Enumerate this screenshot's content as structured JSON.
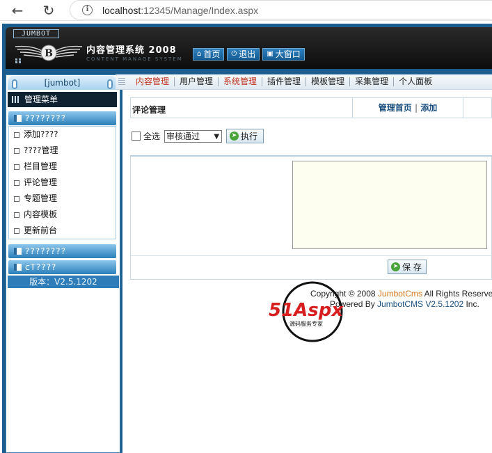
{
  "browser": {
    "url_host": "localhost",
    "url_path": ":12345/Manage/Index.aspx"
  },
  "header": {
    "brand_tag": "JUMBOT",
    "title": "内容管理系统 2008",
    "subtitle": "CONTENT MANAGE SYSTEM",
    "buttons": [
      {
        "label": "首页",
        "icon": "home-icon"
      },
      {
        "label": "退出",
        "icon": "power-icon"
      },
      {
        "label": "大窗口",
        "icon": "fullscreen-icon"
      }
    ]
  },
  "sidebar": {
    "user": "[jumbot]",
    "menu_title": "管理菜单",
    "section1": "????????",
    "items": [
      {
        "label": "添加????"
      },
      {
        "label": "????管理"
      },
      {
        "label": "栏目管理"
      },
      {
        "label": "评论管理"
      },
      {
        "label": "专题管理"
      },
      {
        "label": "内容模板"
      },
      {
        "label": "更新前台"
      }
    ],
    "section2": "????????",
    "section3": "cT????",
    "version": "版本：V2.5.1202"
  },
  "tabs": [
    {
      "label": "内容管理",
      "red": true
    },
    {
      "label": "用户管理",
      "red": false
    },
    {
      "label": "系统管理",
      "red": true
    },
    {
      "label": "插件管理",
      "red": false
    },
    {
      "label": "模板管理",
      "red": false
    },
    {
      "label": "采集管理",
      "red": false
    },
    {
      "label": "个人面板",
      "red": false
    }
  ],
  "content": {
    "title": "评论管理",
    "link_home": "管理首页",
    "link_sep": "|",
    "link_add": "添加",
    "select_all": "全选",
    "select_value": "审核通过",
    "exec_label": "执行",
    "save_label": "保 存"
  },
  "footer": {
    "copy_prefix": "Copyright © 2008 ",
    "copy_org": "JumbotCms",
    "copy_suffix": " All Rights Reserved",
    "powered_prefix": "Powered By ",
    "powered_name": "JumbotCMS V2.5.1202",
    "powered_suffix": " Inc."
  },
  "watermark": {
    "brand": "51Aspx",
    "tagline": "源码服务专家"
  }
}
